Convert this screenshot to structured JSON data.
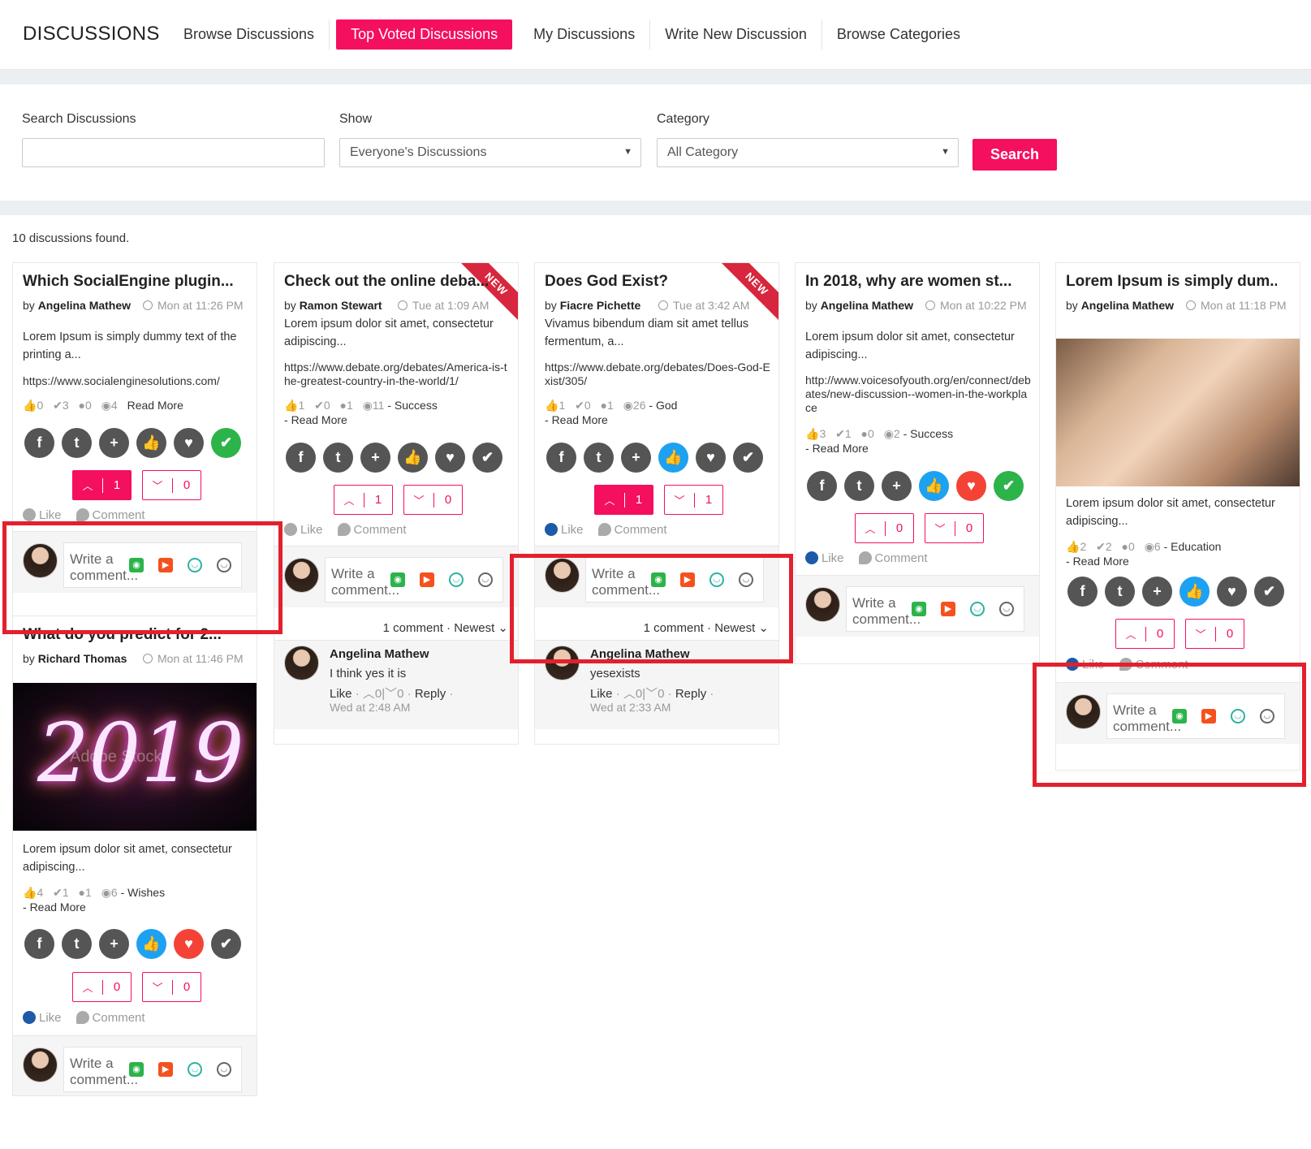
{
  "header": {
    "brand": "DISCUSSIONS",
    "nav": [
      "Browse Discussions",
      "Top Voted Discussions",
      "My Discussions",
      "Write New Discussion",
      "Browse Categories"
    ],
    "active_index": 1
  },
  "form": {
    "search_label": "Search Discussions",
    "search_value": "",
    "show_label": "Show",
    "show_value": "Everyone's Discussions",
    "category_label": "Category",
    "category_value": "All Category",
    "search_button": "Search"
  },
  "results_text": "10 discussions found.",
  "ui": {
    "read_more": "Read More",
    "like": "Like",
    "comment": "Comment",
    "write_comment": "Write a comment...",
    "new_badge": "NEW",
    "newest": "Newest",
    "reply": "Reply",
    "comment_count_1": "1 comment"
  },
  "cards": [
    {
      "title": "Which SocialEngine plugin...",
      "by": "by",
      "author": "Angelina Mathew",
      "date": "Mon at 11:26 PM",
      "desc": "Lorem Ipsum is simply dummy text of the printing a...",
      "link": "https://www.socialenginesolutions.com/",
      "likes": "0",
      "checks": "3",
      "comments": "0",
      "views": "4",
      "category": "",
      "upvotes": "1",
      "downvotes": "0"
    },
    {
      "title": "Check out the online deba...",
      "by": "by",
      "author": "Ramon Stewart",
      "date": "Tue at 1:09 AM",
      "desc": "Lorem ipsum dolor sit amet, consectetur adipiscing...",
      "link": "https://www.debate.org/debates/America-is-the-greatest-country-in-the-world/1/",
      "likes": "1",
      "checks": "0",
      "comments": "1",
      "views": "11",
      "category": "Success",
      "upvotes": "1",
      "downvotes": "0",
      "comment_author": "Angelina Mathew",
      "comment_text": "I think yes it is",
      "comment_up": "0",
      "comment_down": "0",
      "comment_date": "Wed at 2:48 AM"
    },
    {
      "title": "Does God Exist?",
      "by": "by",
      "author": "Fiacre Pichette",
      "date": "Tue at 3:42 AM",
      "desc": "Vivamus bibendum diam sit amet tellus fermentum, a...",
      "link": "https://www.debate.org/debates/Does-God-Exist/305/",
      "likes": "1",
      "checks": "0",
      "comments": "1",
      "views": "26",
      "category": "God",
      "upvotes": "1",
      "downvotes": "1",
      "comment_author": "Angelina Mathew",
      "comment_text": "yesexists",
      "comment_up": "0",
      "comment_down": "0",
      "comment_date": "Wed at 2:33 AM"
    },
    {
      "title": "In 2018, why are women st...",
      "by": "by",
      "author": "Angelina Mathew",
      "date": "Mon at 10:22 PM",
      "desc": "Lorem ipsum dolor sit amet, consectetur adipiscing...",
      "link": "http://www.voicesofyouth.org/en/connect/debates/new-discussion--women-in-the-workplace",
      "likes": "3",
      "checks": "1",
      "comments": "0",
      "views": "2",
      "category": "Success",
      "upvotes": "0",
      "downvotes": "0"
    },
    {
      "title": "Lorem Ipsum is simply dum...",
      "by": "by",
      "author": "Angelina Mathew",
      "date": "Mon at 11:18 PM",
      "desc": "Lorem ipsum dolor sit amet, consectetur adipiscing...",
      "likes": "2",
      "checks": "2",
      "comments": "0",
      "views": "6",
      "category": "Education",
      "upvotes": "0",
      "downvotes": "0"
    },
    {
      "title": "What do you predict for 2...",
      "by": "by",
      "author": "Richard Thomas",
      "date": "Mon at 11:46 PM",
      "desc": "Lorem ipsum dolor sit amet, consectetur adipiscing...",
      "image_text": "2019",
      "watermark": "Adobe Stock",
      "likes": "4",
      "checks": "1",
      "comments": "1",
      "views": "6",
      "category": "Wishes",
      "upvotes": "0",
      "downvotes": "0"
    }
  ],
  "colors": {
    "accent": "#f50f5f",
    "highlight": "#e3202d",
    "like_blue": "#1da1f2",
    "green": "#2cb34a",
    "red": "#f44336"
  },
  "icons": [
    "facebook-icon",
    "twitter-icon",
    "plus-icon",
    "thumbs-up-icon",
    "heart-icon",
    "check-icon",
    "camera-icon",
    "video-icon",
    "emoji-icon",
    "sticker-icon",
    "clock-icon"
  ]
}
